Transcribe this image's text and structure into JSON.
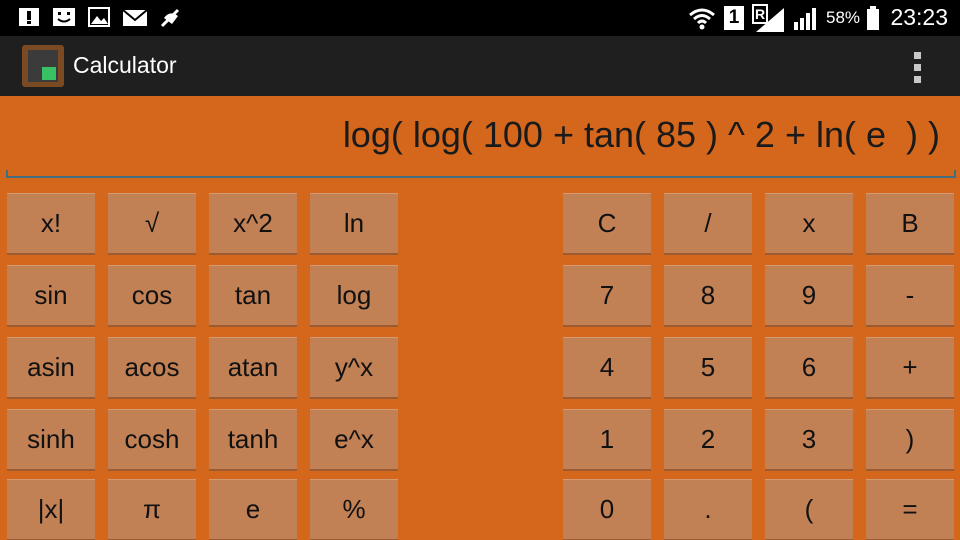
{
  "status_bar": {
    "battery_percent": "58%",
    "time": "23:23",
    "sim_slot": "1",
    "roaming": "R",
    "icons": [
      "alert-icon",
      "smiley-icon",
      "image-icon",
      "email-icon",
      "mute-icon",
      "wifi-icon",
      "sim-1-icon",
      "roaming-signal-icon",
      "signal-icon",
      "battery-icon"
    ]
  },
  "action_bar": {
    "title": "Calculator",
    "icon": "calculator-app-icon",
    "menu_icon": "overflow-menu-icon"
  },
  "display": {
    "expression": "log( log( 100 + tan( 85 ) ^ 2 + ln( e  ) )"
  },
  "keypad": {
    "scientific": [
      [
        "x!",
        "√",
        "x^2",
        "ln"
      ],
      [
        "sin",
        "cos",
        "tan",
        "log"
      ],
      [
        "asin",
        "acos",
        "atan",
        "y^x"
      ],
      [
        "sinh",
        "cosh",
        "tanh",
        "e^x"
      ],
      [
        "|x|",
        "π",
        "e",
        "%"
      ]
    ],
    "numeric": [
      [
        "C",
        "/",
        "x",
        "B"
      ],
      [
        "7",
        "8",
        "9",
        "-"
      ],
      [
        "4",
        "5",
        "6",
        "+"
      ],
      [
        "1",
        "2",
        "3",
        ")"
      ],
      [
        "0",
        ".",
        "(",
        "="
      ]
    ]
  },
  "colors": {
    "background": "#d5671d",
    "key": "#c28055",
    "status_bar": "#000000",
    "action_bar": "#1f1f1f"
  }
}
